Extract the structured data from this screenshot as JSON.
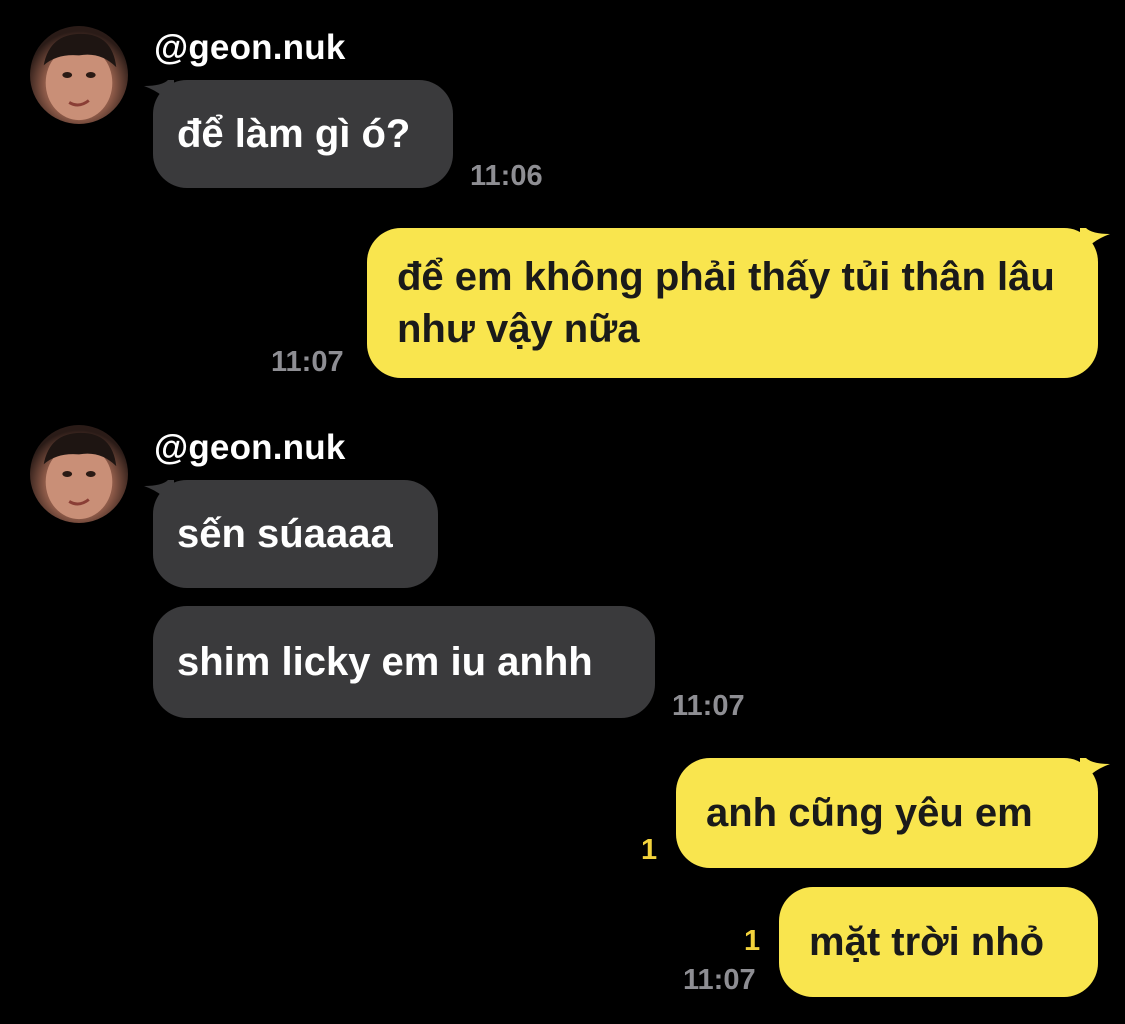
{
  "sender": {
    "username": "@geon.nuk"
  },
  "messages": [
    {
      "text": "để làm gì ó?",
      "time": "11:06"
    },
    {
      "text": "để em không phải thấy tủi thân lâu như vậy nữa",
      "time": "11:07"
    },
    {
      "text": "sến súaaaa"
    },
    {
      "text": "shim licky em iu anhh",
      "time": "11:07"
    },
    {
      "text": "anh cũng yêu em",
      "unread": "1"
    },
    {
      "text": "mặt trời nhỏ",
      "unread": "1",
      "time": "11:07"
    }
  ],
  "colors": {
    "background": "#000000",
    "incoming": "#3a3a3c",
    "outgoing": "#f9e54e",
    "unread": "#f2d23c",
    "time": "#8e8e93"
  }
}
